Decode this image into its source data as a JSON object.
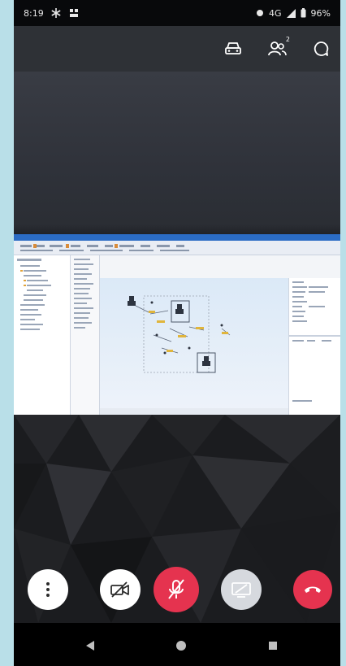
{
  "status_bar": {
    "time": "8:19",
    "network": "4G",
    "battery": "96%"
  },
  "top_bar": {
    "participants_count": "2",
    "icons": [
      "car-mode-icon",
      "participants-icon",
      "chat-icon"
    ]
  },
  "controls": {
    "buttons": [
      {
        "name": "more-options",
        "icon": "more-vertical-icon"
      },
      {
        "name": "video-toggle",
        "icon": "video-off-icon"
      },
      {
        "name": "mic-toggle",
        "icon": "mic-off-icon"
      },
      {
        "name": "screen-share",
        "icon": "screen-share-icon"
      },
      {
        "name": "hang-up",
        "icon": "hang-up-icon"
      }
    ]
  },
  "colors": {
    "accent_red": "#e5334f",
    "top_bar": "#2e3136",
    "side_background": "#b9dfe8"
  }
}
